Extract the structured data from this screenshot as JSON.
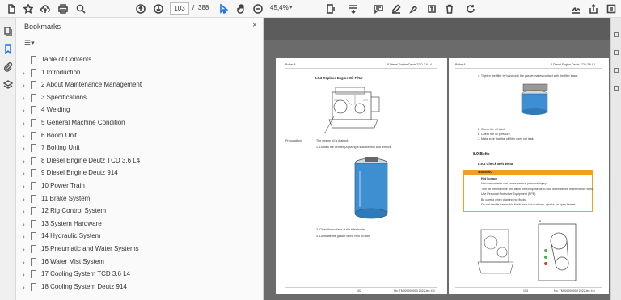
{
  "toolbar": {
    "current_page": "103",
    "page_separator": "/",
    "total_pages": "388",
    "zoom": "45,4%",
    "zoom_caret": "▾"
  },
  "bookmarks": {
    "title": "Bookmarks",
    "close": "×",
    "options_icon": "☰▾",
    "items": [
      {
        "label": "Table of Contents",
        "expandable": false
      },
      {
        "label": "1 Introduction",
        "expandable": true
      },
      {
        "label": "2 About Maintenance Management",
        "expandable": true
      },
      {
        "label": "3 Specifications",
        "expandable": true
      },
      {
        "label": "4 Welding",
        "expandable": true
      },
      {
        "label": "5 General Machine Condition",
        "expandable": true
      },
      {
        "label": "6 Boom Unit",
        "expandable": true
      },
      {
        "label": "7 Bolting Unit",
        "expandable": true
      },
      {
        "label": "8 Diesel Engine Deutz TCD 3.6 L4",
        "expandable": true
      },
      {
        "label": "9 Diesel Engine Deutz 914",
        "expandable": true
      },
      {
        "label": "10 Power Train",
        "expandable": true
      },
      {
        "label": "11 Brake System",
        "expandable": true
      },
      {
        "label": "12 Rig Control System",
        "expandable": true
      },
      {
        "label": "13 System Hardware",
        "expandable": true
      },
      {
        "label": "14 Hydraulic System",
        "expandable": true
      },
      {
        "label": "15 Pneumatic and Water Systems",
        "expandable": true
      },
      {
        "label": "16 Water Mist System",
        "expandable": true
      },
      {
        "label": "17 Cooling System TCD 3.6 L4",
        "expandable": true
      },
      {
        "label": "18 Cooling System Deutz 914",
        "expandable": true
      }
    ]
  },
  "document": {
    "left_page": {
      "header_left": "Bolter A",
      "header_right": "8 Diesel Engine Deutz TCD 3.6 L4",
      "section": "8.6.3 Replace Engine Oil Filter",
      "callout": "A",
      "precondition_label": "Precondition",
      "precondition": "The engine oil is drained.",
      "step1": "1.   Loosen the oil filter (A) using a suitable tool and remove.",
      "step2": "2.   Clean the surface of the filter holder.",
      "step3": "3.   Lubricate the gasket of the new oil filter.",
      "footer_left": "102",
      "footer_right": "No. TM000000000 2022-tec 4.0"
    },
    "right_page": {
      "header_left": "Bolter A",
      "header_right": "8 Diesel Engine Deutz TCD 3.6 L4",
      "step4": "4.   Tighten the filter by hand until the gasket makes contact with the filter base.",
      "step5": "5.   Check the oil level.",
      "step6": "6.   Check the oil pressure.",
      "step7": "7.   Make sure that the oil filter does not leak.",
      "section": "8.9  Belts",
      "subsection": "8.9.1 Check Belt Wear",
      "warning_title": "WARNING",
      "warning_head": "Hot Surface",
      "warning_lines": [
        "Hot components can cause serious personal injury.",
        "Turn off the machine and allow the components to cool down before maintenance work.",
        "Use Personal Protective Equipment (PPE).",
        "Be careful when draining hot fluids.",
        "Do not handle flammable fluids near hot surfaces, sparks, or open flames."
      ],
      "callout": "B",
      "footer_left": "103",
      "footer_right": "No. TM000000000 2022-tec 4.0"
    }
  },
  "colors": {
    "accent": "#1a73e8",
    "warning": "#f0a020",
    "canvas": "#6b6b6b"
  }
}
